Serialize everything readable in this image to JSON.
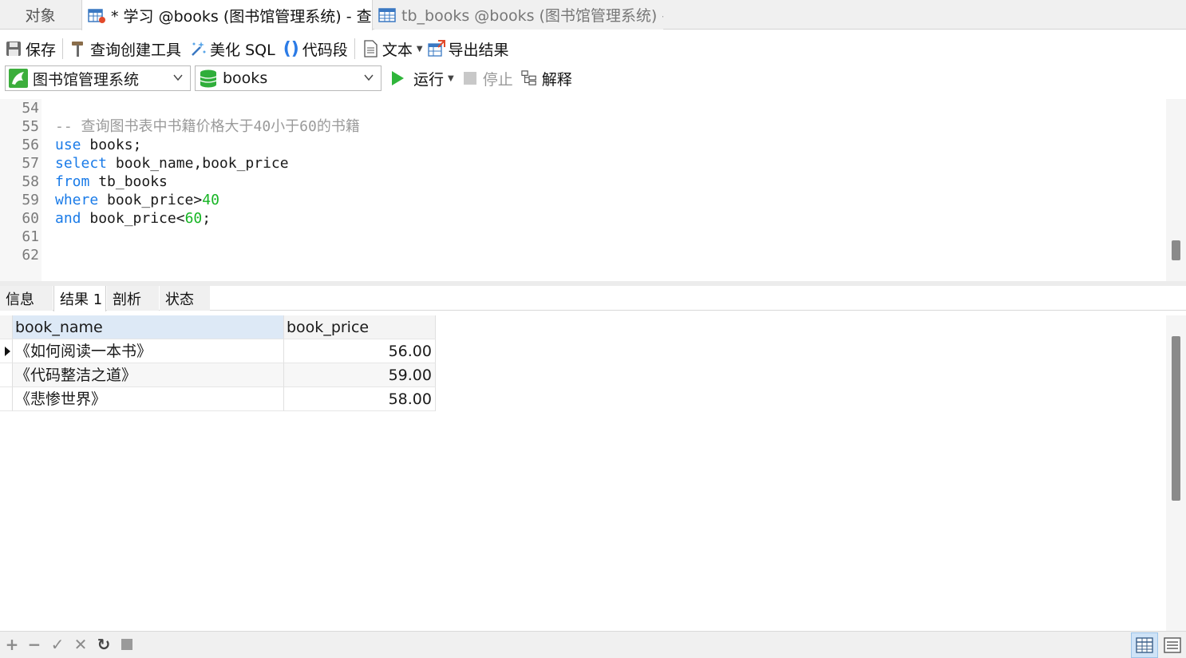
{
  "tabs": {
    "objects": "对象",
    "query": "* 学习 @books (图书馆管理系统) - 查询",
    "table": "tb_books @books (图书馆管理系统) -..."
  },
  "toolbar": {
    "save": "保存",
    "query_builder": "查询创建工具",
    "beautify": "美化 SQL",
    "snippet": "代码段",
    "text": "文本",
    "export": "导出结果"
  },
  "selectors": {
    "connection": "图书馆管理系统",
    "database": "books",
    "run": "运行",
    "stop": "停止",
    "explain": "解释"
  },
  "editor": {
    "lines": [
      {
        "num": "54",
        "parts": []
      },
      {
        "num": "55",
        "parts": [
          {
            "t": "cmt",
            "v": "-- 查询图书表中书籍价格大于40小于60的书籍"
          }
        ]
      },
      {
        "num": "56",
        "parts": [
          {
            "t": "kw",
            "v": "use"
          },
          {
            "t": "txt",
            "v": " books;"
          }
        ]
      },
      {
        "num": "57",
        "parts": [
          {
            "t": "kw",
            "v": "select"
          },
          {
            "t": "txt",
            "v": " book_name,book_price"
          }
        ]
      },
      {
        "num": "58",
        "parts": [
          {
            "t": "kw",
            "v": "from"
          },
          {
            "t": "txt",
            "v": " tb_books"
          }
        ]
      },
      {
        "num": "59",
        "parts": [
          {
            "t": "kw",
            "v": "where"
          },
          {
            "t": "txt",
            "v": " book_price>"
          },
          {
            "t": "num",
            "v": "40"
          }
        ]
      },
      {
        "num": "60",
        "parts": [
          {
            "t": "kw",
            "v": "and"
          },
          {
            "t": "txt",
            "v": " book_price<"
          },
          {
            "t": "num",
            "v": "60"
          },
          {
            "t": "txt",
            "v": ";"
          }
        ]
      },
      {
        "num": "61",
        "parts": []
      },
      {
        "num": "62",
        "parts": []
      }
    ]
  },
  "result_tabs": [
    "信息",
    "结果 1",
    "剖析",
    "状态"
  ],
  "result_active_tab": 1,
  "grid": {
    "columns": [
      "book_name",
      "book_price"
    ],
    "rows": [
      [
        "《如何阅读一本书》",
        "56.00"
      ],
      [
        "《代码整洁之道》",
        "59.00"
      ],
      [
        "《悲惨世界》",
        "58.00"
      ]
    ]
  },
  "bottom_bar": {
    "actions": [
      "plus-icon",
      "minus-icon",
      "check-icon",
      "close-icon",
      "refresh-icon",
      "stop-icon"
    ],
    "views": [
      "grid-view-icon",
      "form-view-icon"
    ]
  },
  "colors": {
    "keyword": "#1a7be8",
    "number": "#16b524",
    "comment": "#9a9a9a",
    "header_selected": "#dde9f6"
  }
}
